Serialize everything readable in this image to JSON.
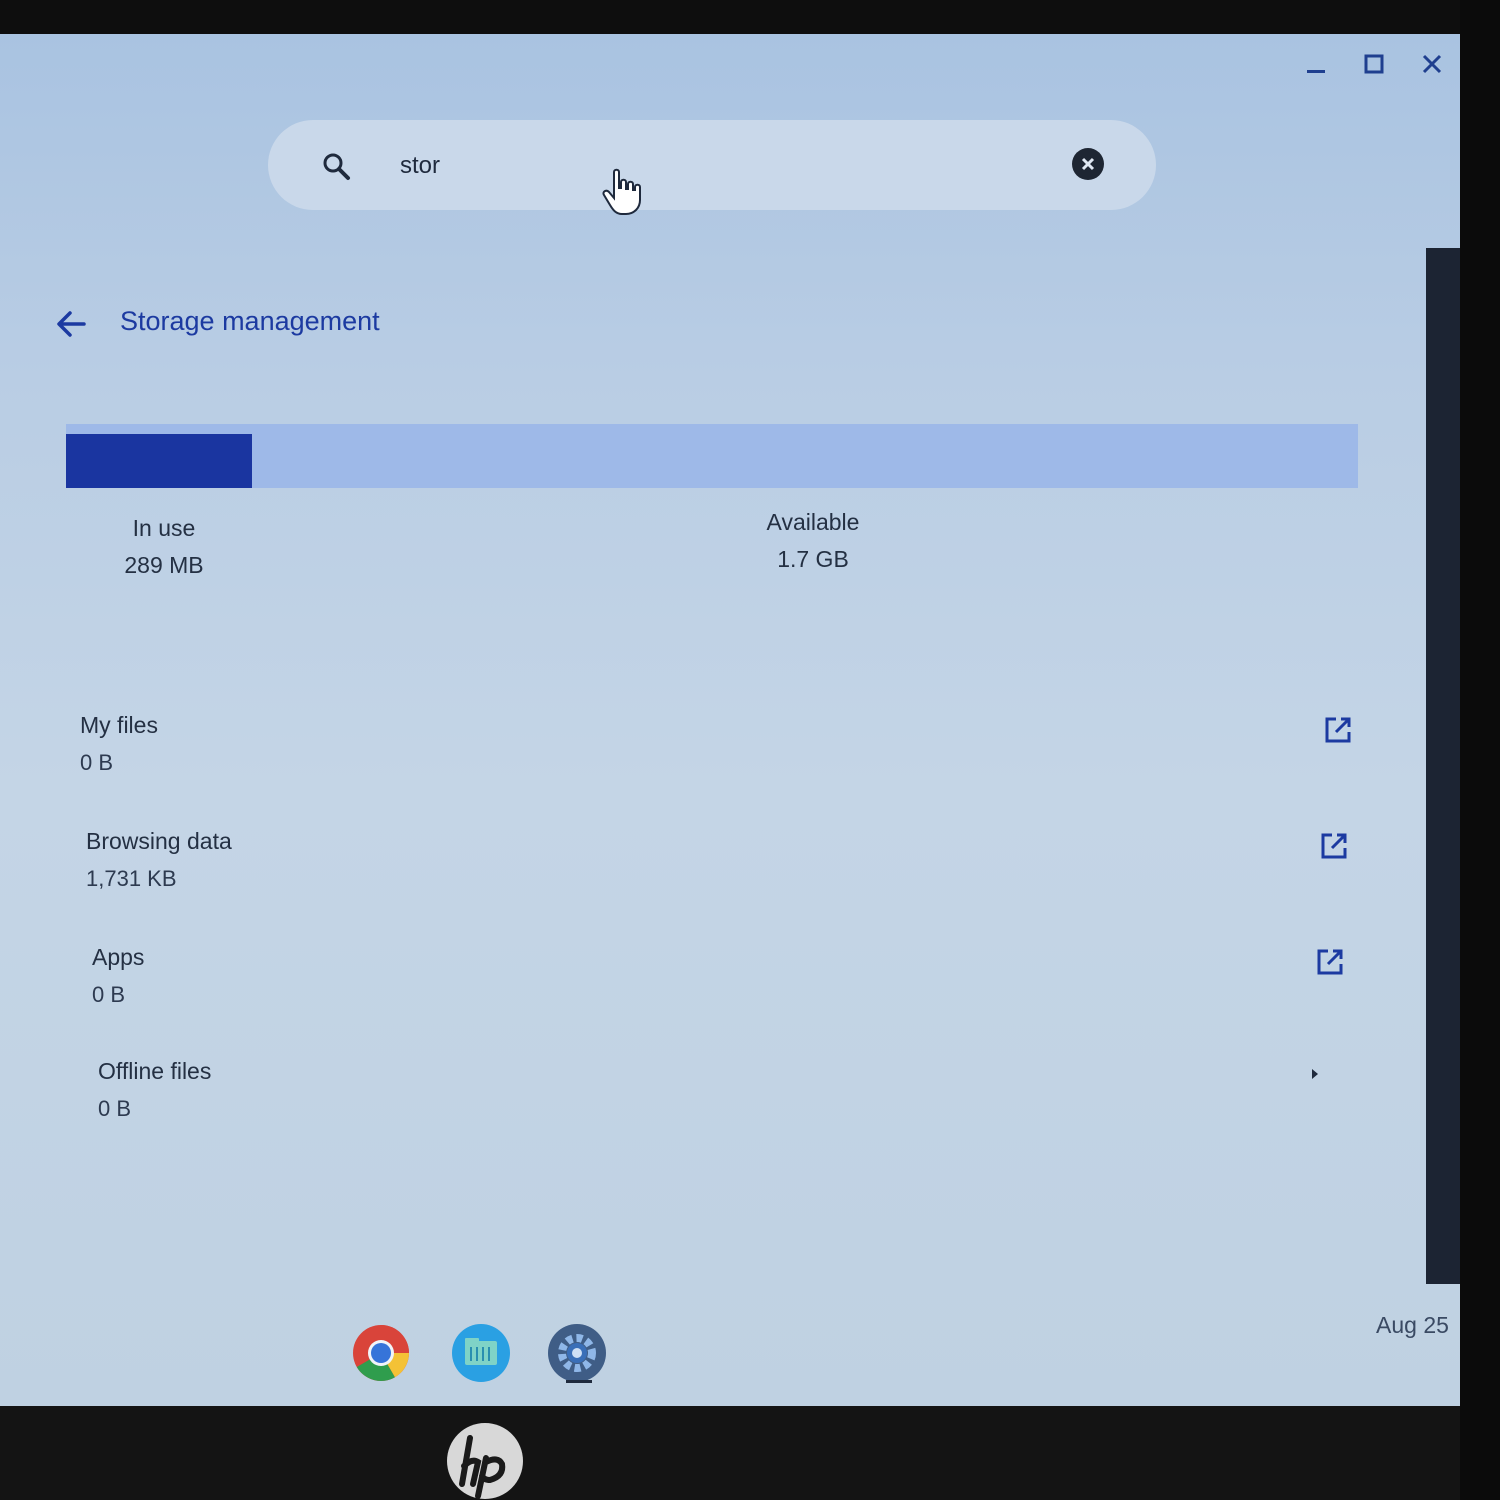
{
  "window": {
    "buttons": [
      "minimize-icon",
      "maximize-icon",
      "close-icon"
    ]
  },
  "search": {
    "value": "stor"
  },
  "page": {
    "title": "Storage management"
  },
  "storage": {
    "in_use": {
      "label": "In use",
      "value": "289 MB"
    },
    "available": {
      "label": "Available",
      "value": "1.7 GB"
    },
    "used_fraction": 0.144
  },
  "items": [
    {
      "label": "My files",
      "value": "0 B",
      "action": "open-external-icon"
    },
    {
      "label": "Browsing data",
      "value": "1,731 KB",
      "action": "open-external-icon"
    },
    {
      "label": "Apps",
      "value": "0 B",
      "action": "open-external-icon"
    },
    {
      "label": "Offline files",
      "value": "0 B",
      "action": "chevron-right-icon"
    }
  ],
  "shelf": {
    "date": "Aug 25",
    "apps": [
      "chrome-icon",
      "files-icon",
      "settings-icon"
    ]
  },
  "colors": {
    "accent": "#1a35a0",
    "bar_track": "#9eb9e8",
    "text": "#243043"
  }
}
